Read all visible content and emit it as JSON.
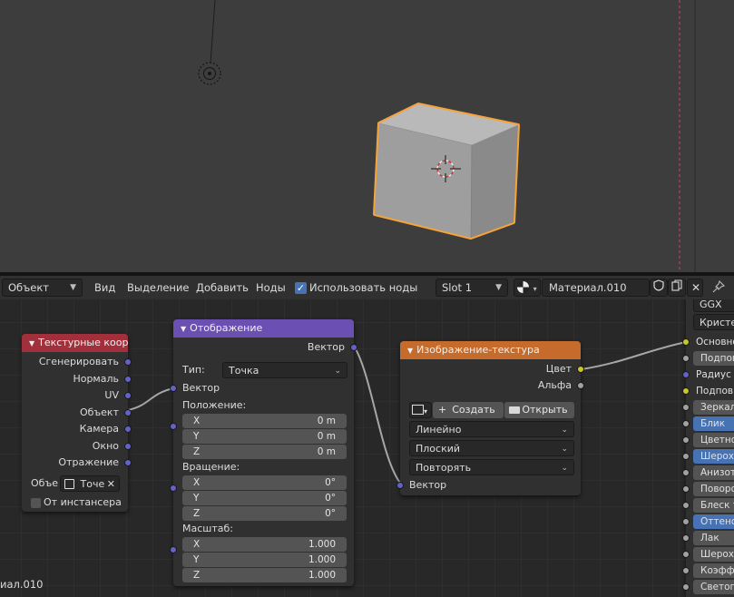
{
  "header": {
    "mode_select": "Объект",
    "menu_view": "Вид",
    "menu_select": "Выделение",
    "menu_add": "Добавить",
    "menu_nodes": "Ноды",
    "use_nodes_label": "Использовать ноды",
    "use_nodes_checked": true,
    "slot": "Slot 1",
    "material_name": "Материал.010"
  },
  "texcoord_node": {
    "title": "Текстурные коор...",
    "outputs": [
      "Сгенерировать",
      "Нормаль",
      "UV",
      "Объект",
      "Камера",
      "Окно",
      "Отражение"
    ],
    "object_label": "Объе",
    "object_value": "Точе",
    "instancer_label": "От инстансера"
  },
  "mapping_node": {
    "title": "Отображение",
    "output_vector": "Вектор",
    "type_label": "Тип:",
    "type_value": "Точка",
    "input_vector": "Вектор",
    "location_label": "Положение:",
    "location": [
      {
        "axis": "X",
        "value": "0 m"
      },
      {
        "axis": "Y",
        "value": "0 m"
      },
      {
        "axis": "Z",
        "value": "0 m"
      }
    ],
    "rotation_label": "Вращение:",
    "rotation": [
      {
        "axis": "X",
        "value": "0°"
      },
      {
        "axis": "Y",
        "value": "0°"
      },
      {
        "axis": "Z",
        "value": "0°"
      }
    ],
    "scale_label": "Масштаб:",
    "scale": [
      {
        "axis": "X",
        "value": "1.000"
      },
      {
        "axis": "Y",
        "value": "1.000"
      },
      {
        "axis": "Z",
        "value": "1.000"
      }
    ]
  },
  "image_node": {
    "title": "Изображение-текстура",
    "out_color": "Цвет",
    "out_alpha": "Альфа",
    "new_label": "Создать",
    "open_label": "Открыть",
    "interpolation": "Линейно",
    "projection": "Плоский",
    "extension": "Повторять",
    "input_vector": "Вектор"
  },
  "bsdf_panel": {
    "distribution": "GGX",
    "subsurface_method": "Кристен",
    "items": [
      {
        "label": "Основной",
        "style": "plain",
        "socket": "yellow"
      },
      {
        "label": "Подпов",
        "style": "field",
        "socket": "gray"
      },
      {
        "label": "Радиус",
        "style": "plain",
        "socket": "purple"
      },
      {
        "label": "Подпов.",
        "style": "plain",
        "socket": "yellow"
      },
      {
        "label": "Зеркал",
        "style": "field",
        "socket": "gray"
      },
      {
        "label": "Блик",
        "style": "blue",
        "socket": "gray"
      },
      {
        "label": "Цветно",
        "style": "field",
        "socket": "gray"
      },
      {
        "label": "Шерох",
        "style": "blue",
        "socket": "gray"
      },
      {
        "label": "Анизотр",
        "style": "field",
        "socket": "gray"
      },
      {
        "label": "Поворо",
        "style": "field",
        "socket": "gray"
      },
      {
        "label": "Блеск т",
        "style": "field",
        "socket": "gray"
      },
      {
        "label": "Оттено",
        "style": "blue",
        "socket": "gray"
      },
      {
        "label": "Лак",
        "style": "field",
        "socket": "gray"
      },
      {
        "label": "Шерох",
        "style": "field",
        "socket": "gray"
      },
      {
        "label": "Коэфф",
        "style": "field",
        "socket": "gray"
      },
      {
        "label": "Светопр",
        "style": "field",
        "socket": "gray"
      }
    ]
  },
  "footer": {
    "material_label": "иал.010"
  },
  "colors": {
    "texcoord_header": "#a2303c",
    "mapping_header": "#6b4fb3",
    "image_header": "#c56b2c",
    "selection_outline": "#f5a33a"
  }
}
